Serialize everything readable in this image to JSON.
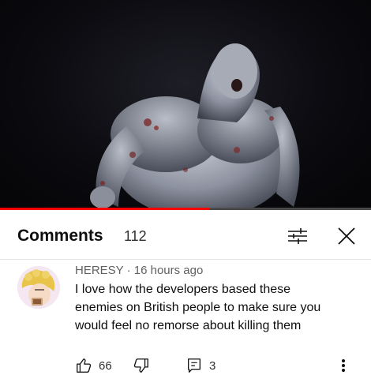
{
  "video": {
    "progress_fraction": 0.565
  },
  "comments_panel": {
    "title": "Comments",
    "count": "112"
  },
  "comment": {
    "author": "HERESY",
    "separator": "·",
    "time": "16 hours ago",
    "lines": [
      "I love how the developers based these",
      "enemies on British people to make sure you",
      "would feel no remorse about killing them"
    ],
    "likes": "66",
    "replies": "3"
  },
  "colors": {
    "progress": "#ff0000",
    "track": "#4a4a4a"
  }
}
